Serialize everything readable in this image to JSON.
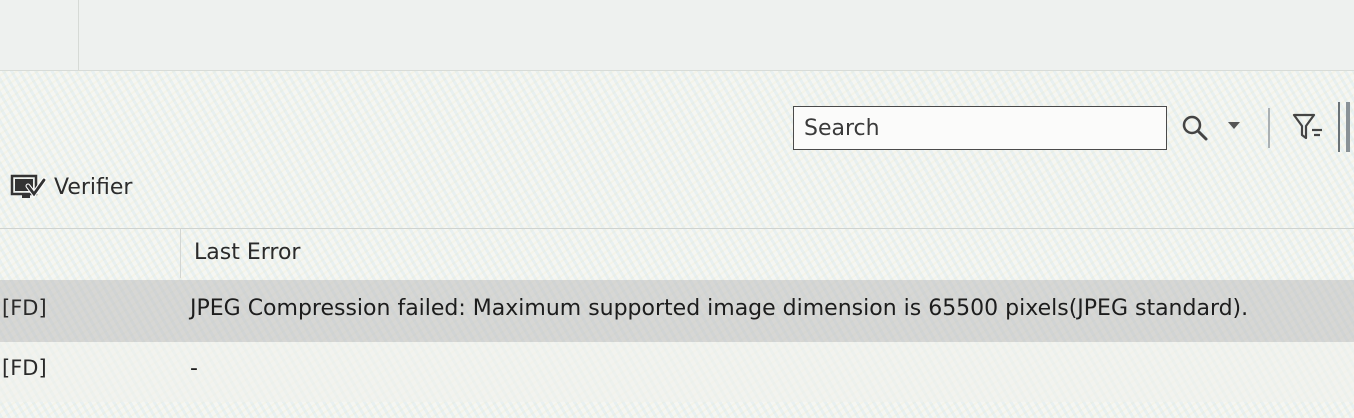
{
  "toolbar": {
    "search_placeholder": "Search",
    "icons": [
      "search-icon",
      "chevron-down-icon",
      "filter-icon"
    ]
  },
  "panel": {
    "title": "Verifier",
    "icon": "verifier-icon"
  },
  "grid": {
    "columns": [
      "Last Error"
    ],
    "rows": [
      {
        "id": "[FD]",
        "last_error": "JPEG Compression failed: Maximum supported image dimension is 65500 pixels(JPEG standard).",
        "selected": true
      },
      {
        "id": "[FD]",
        "last_error": "-",
        "selected": false
      }
    ]
  },
  "colors": {
    "selected_row": "#bebebe",
    "border": "#4a4a4a"
  }
}
